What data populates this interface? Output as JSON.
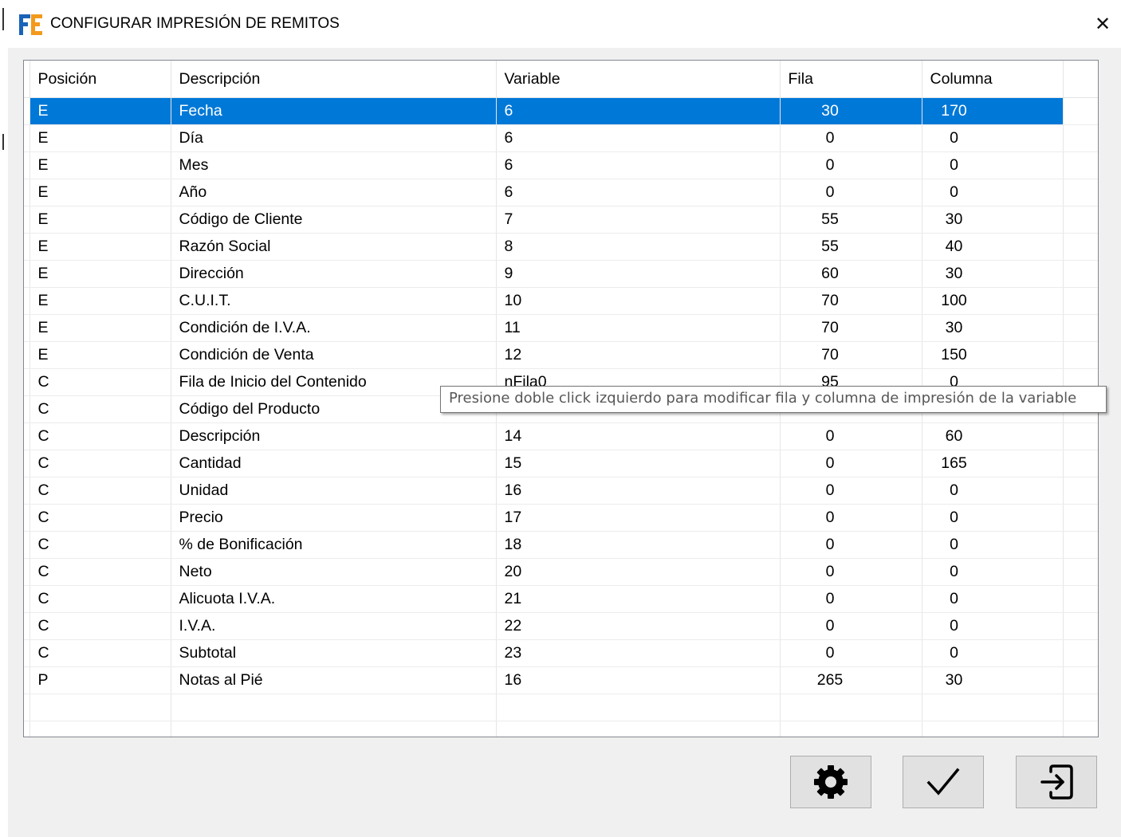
{
  "window": {
    "title": "CONFIGURAR IMPRESIÓN DE REMITOS",
    "close_glyph": "✕"
  },
  "grid": {
    "columns": [
      "Posición",
      "Descripción",
      "Variable",
      "Fila",
      "Columna"
    ],
    "rows": [
      [
        "E",
        "Fecha",
        "6",
        "30",
        "170"
      ],
      [
        "E",
        "Día",
        "6",
        "0",
        "0"
      ],
      [
        "E",
        "Mes",
        "6",
        "0",
        "0"
      ],
      [
        "E",
        "Año",
        "6",
        "0",
        "0"
      ],
      [
        "E",
        "Código de Cliente",
        "7",
        "55",
        "30"
      ],
      [
        "E",
        "Razón Social",
        "8",
        "55",
        "40"
      ],
      [
        "E",
        "Dirección",
        "9",
        "60",
        "30"
      ],
      [
        "E",
        "C.U.I.T.",
        "10",
        "70",
        "100"
      ],
      [
        "E",
        "Condición de I.V.A.",
        "11",
        "70",
        "30"
      ],
      [
        "E",
        "Condición de Venta",
        "12",
        "70",
        "150"
      ],
      [
        "C",
        "Fila de Inicio del Contenido",
        "nFila0",
        "95",
        "0"
      ],
      [
        "C",
        "Código del Producto",
        "",
        "",
        ""
      ],
      [
        "C",
        "Descripción",
        "14",
        "0",
        "60"
      ],
      [
        "C",
        "Cantidad",
        "15",
        "0",
        "165"
      ],
      [
        "C",
        "Unidad",
        "16",
        "0",
        "0"
      ],
      [
        "C",
        "Precio",
        "17",
        "0",
        "0"
      ],
      [
        "C",
        "% de Bonificación",
        "18",
        "0",
        "0"
      ],
      [
        "C",
        "Neto",
        "20",
        "0",
        "0"
      ],
      [
        "C",
        "Alicuota I.V.A.",
        "21",
        "0",
        "0"
      ],
      [
        "C",
        "I.V.A.",
        "22",
        "0",
        "0"
      ],
      [
        "C",
        "Subtotal",
        "23",
        "0",
        "0"
      ],
      [
        "P",
        "Notas al Pié",
        "16",
        "265",
        "30"
      ]
    ],
    "selected_row": 0
  },
  "tooltip": {
    "text": "Presione doble click izquierdo para modificar fila y columna de impresión de la variable"
  },
  "buttons": {
    "settings": "gear-icon",
    "confirm": "checkmark-icon",
    "exit": "exit-icon"
  },
  "colors": {
    "selection": "#0078d7",
    "logo_blue": "#1a63b8",
    "logo_orange": "#f39a1c"
  }
}
